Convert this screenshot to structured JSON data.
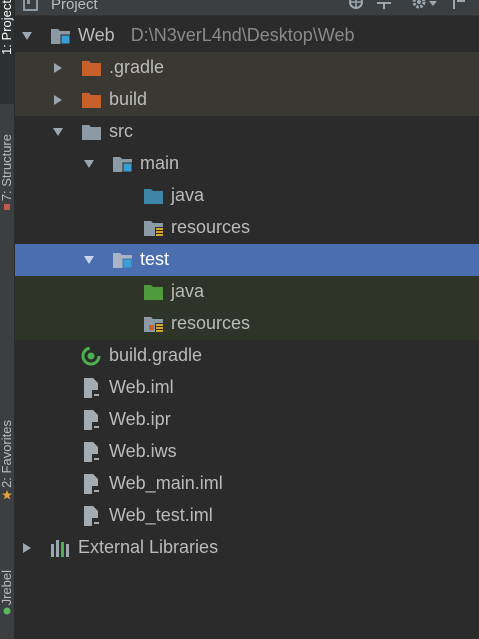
{
  "toolbar": {
    "title": "Project"
  },
  "sidebar": {
    "tabs": [
      {
        "label": "1: Project"
      },
      {
        "label": "7: Structure"
      },
      {
        "label": "2: Favorites"
      },
      {
        "label": "Jrebel"
      }
    ]
  },
  "tree": {
    "items": [
      {
        "label": "Web",
        "path": "D:\\N3verL4nd\\Desktop\\Web",
        "icon": "module-folder-icon",
        "state": "expanded"
      },
      {
        "label": ".gradle",
        "icon": "excluded-folder-icon",
        "state": "collapsed"
      },
      {
        "label": "build",
        "icon": "excluded-folder-icon",
        "state": "collapsed"
      },
      {
        "label": "src",
        "icon": "folder-icon",
        "state": "expanded"
      },
      {
        "label": "main",
        "icon": "module-folder-icon",
        "state": "expanded"
      },
      {
        "label": "java",
        "icon": "source-root-icon"
      },
      {
        "label": "resources",
        "icon": "resources-root-icon"
      },
      {
        "label": "test",
        "icon": "module-folder-icon",
        "state": "expanded",
        "selected": true
      },
      {
        "label": "java",
        "icon": "test-source-root-icon"
      },
      {
        "label": "resources",
        "icon": "test-resources-root-icon"
      },
      {
        "label": "build.gradle",
        "icon": "gradle-icon"
      },
      {
        "label": "Web.iml",
        "icon": "file-icon"
      },
      {
        "label": "Web.ipr",
        "icon": "file-icon"
      },
      {
        "label": "Web.iws",
        "icon": "file-icon"
      },
      {
        "label": "Web_main.iml",
        "icon": "file-icon"
      },
      {
        "label": "Web_test.iml",
        "icon": "file-icon"
      },
      {
        "label": "External Libraries",
        "icon": "libraries-icon",
        "state": "collapsed"
      }
    ]
  },
  "colors": {
    "background": "#2b2b2b",
    "selection": "#4b6eaf",
    "excluded_row": "#3a3833",
    "test_row": "#2e3428",
    "excluded_folder": "#c8602c",
    "source_folder": "#3d86a8",
    "test_folder": "#4f9a3b",
    "folder": "#8b9aa5"
  }
}
